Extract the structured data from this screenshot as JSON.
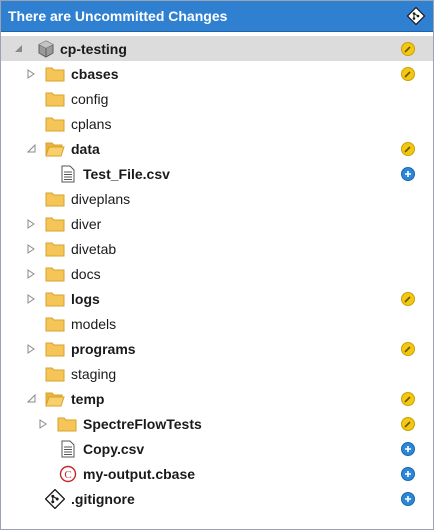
{
  "panel": {
    "title": "There are Uncommitted Changes",
    "title_icon": "git-icon"
  },
  "colors": {
    "title_bg": "#2f80d1",
    "folder": "#f5c558",
    "modified": "#f2c812",
    "added": "#2c87d8",
    "cbase": "#c0282d",
    "selection": "#dcdcdc"
  },
  "tree": {
    "root": {
      "label": "cp-testing",
      "status": "modified"
    },
    "items": [
      {
        "label": "cbases",
        "status": "modified"
      },
      {
        "label": "config"
      },
      {
        "label": "cplans"
      },
      {
        "label": "data",
        "status": "modified"
      },
      {
        "label": "Test_File.csv",
        "status": "added"
      },
      {
        "label": "diveplans"
      },
      {
        "label": "diver"
      },
      {
        "label": "divetab"
      },
      {
        "label": "docs"
      },
      {
        "label": "logs",
        "status": "modified"
      },
      {
        "label": "models"
      },
      {
        "label": "programs",
        "status": "modified"
      },
      {
        "label": "staging"
      },
      {
        "label": "temp",
        "status": "modified"
      },
      {
        "label": "SpectreFlowTests",
        "status": "modified"
      },
      {
        "label": "Copy.csv",
        "status": "added"
      },
      {
        "label": "my-output.cbase",
        "status": "added"
      },
      {
        "label": ".gitignore",
        "status": "added"
      }
    ]
  }
}
